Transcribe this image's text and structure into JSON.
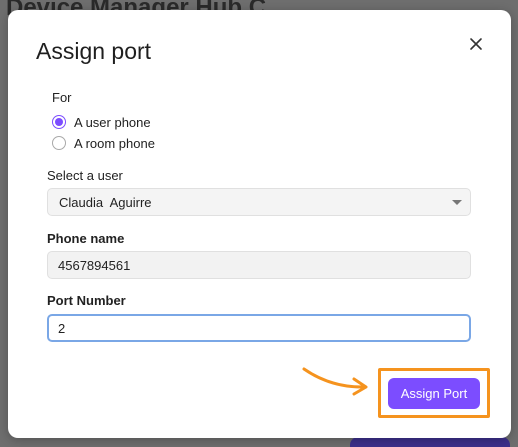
{
  "background": {
    "title": "Device Manager Hub C"
  },
  "modal": {
    "title": "Assign port",
    "close_icon": "close-icon"
  },
  "for_group": {
    "label": "For",
    "options": [
      {
        "label": "A user phone",
        "checked": true
      },
      {
        "label": "A room phone",
        "checked": false
      }
    ]
  },
  "user_select": {
    "label": "Select a user",
    "value": "Claudia  Aguirre"
  },
  "phone_name": {
    "label": "Phone name",
    "value": "4567894561"
  },
  "port_number": {
    "label": "Port Number",
    "value": "2"
  },
  "submit": {
    "label": "Assign Port"
  },
  "colors": {
    "accent": "#7c4dff",
    "highlight": "#f5931e",
    "focus_border": "#7aa7e6"
  }
}
